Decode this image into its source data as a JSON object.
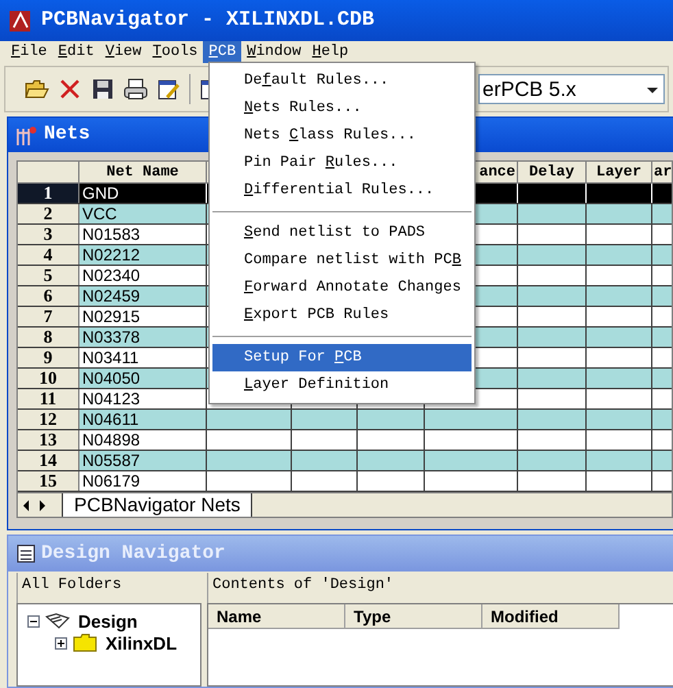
{
  "window": {
    "title": "PCBNavigator - XILINXDL.CDB"
  },
  "menu_bar": [
    {
      "key": "F",
      "rest": "ile",
      "selected": false
    },
    {
      "key": "E",
      "rest": "dit",
      "selected": false
    },
    {
      "key": "V",
      "rest": "iew",
      "selected": false
    },
    {
      "key": "T",
      "rest": "ools",
      "selected": false
    },
    {
      "key": "P",
      "rest": "CB",
      "selected": true
    },
    {
      "key": "W",
      "rest": "indow",
      "selected": false
    },
    {
      "key": "H",
      "rest": "elp",
      "selected": false
    }
  ],
  "toolbar": {
    "target_field": {
      "value": "erPCB 5.x"
    }
  },
  "nets_window": {
    "title": "Nets",
    "columns": [
      {
        "label": "Net Name"
      },
      {},
      {},
      {},
      {
        "label": "ance"
      },
      {
        "label": "Delay"
      },
      {
        "label": "Layer"
      },
      {
        "label": "ar"
      }
    ],
    "rows": [
      {
        "number": "1",
        "net": "GND",
        "selected": true
      },
      {
        "number": "2",
        "net": "VCC",
        "selected": false
      },
      {
        "number": "3",
        "net": "N01583",
        "selected": false
      },
      {
        "number": "4",
        "net": "N02212",
        "selected": false
      },
      {
        "number": "5",
        "net": "N02340",
        "selected": false
      },
      {
        "number": "6",
        "net": "N02459",
        "selected": false
      },
      {
        "number": "7",
        "net": "N02915",
        "selected": false
      },
      {
        "number": "8",
        "net": "N03378",
        "selected": false
      },
      {
        "number": "9",
        "net": "N03411",
        "selected": false
      },
      {
        "number": "10",
        "net": "N04050",
        "selected": false
      },
      {
        "number": "11",
        "net": "N04123",
        "selected": false
      },
      {
        "number": "12",
        "net": "N04611",
        "selected": false
      },
      {
        "number": "13",
        "net": "N04898",
        "selected": false
      },
      {
        "number": "14",
        "net": "N05587",
        "selected": false
      },
      {
        "number": "15",
        "net": "N06179",
        "selected": false
      }
    ],
    "sheet_tab": "PCBNavigator Nets"
  },
  "pcb_menu": [
    {
      "before": "De",
      "key": "f",
      "after": "ault Rules...",
      "selected": false,
      "separator_after": false
    },
    {
      "key": "N",
      "after": "ets Rules...",
      "selected": false,
      "separator_after": false
    },
    {
      "before": "Nets ",
      "key": "C",
      "after": "lass Rules...",
      "selected": false,
      "separator_after": false
    },
    {
      "before": "Pin Pair ",
      "key": "R",
      "after": "ules...",
      "selected": false,
      "separator_after": false
    },
    {
      "key": "D",
      "after": "ifferential Rules...",
      "selected": false,
      "separator_after": true
    },
    {
      "key": "S",
      "after": "end netlist to PADS",
      "selected": false,
      "separator_after": false
    },
    {
      "before": "Compare netlist with PC",
      "key": "B",
      "selected": false,
      "separator_after": false
    },
    {
      "key": "F",
      "after": "orward Annotate Changes",
      "selected": false,
      "separator_after": false
    },
    {
      "key": "E",
      "after": "xport PCB Rules",
      "selected": false,
      "separator_after": true
    },
    {
      "before": "Setup For ",
      "key": "P",
      "after": "CB",
      "selected": true,
      "separator_after": false
    },
    {
      "key": "L",
      "after": "ayer Definition",
      "selected": false,
      "separator_after": false
    }
  ],
  "design_navigator": {
    "title": "Design Navigator",
    "folders_label": "All Folders",
    "contents_label": "Contents of 'Design'",
    "tree": [
      {
        "label": "Design",
        "kind": "book",
        "expanded": true,
        "children": [
          {
            "label": "XilinxDL",
            "kind": "folder",
            "expanded": false
          }
        ]
      }
    ],
    "columns": [
      "Name",
      "Type",
      "Modified"
    ]
  }
}
